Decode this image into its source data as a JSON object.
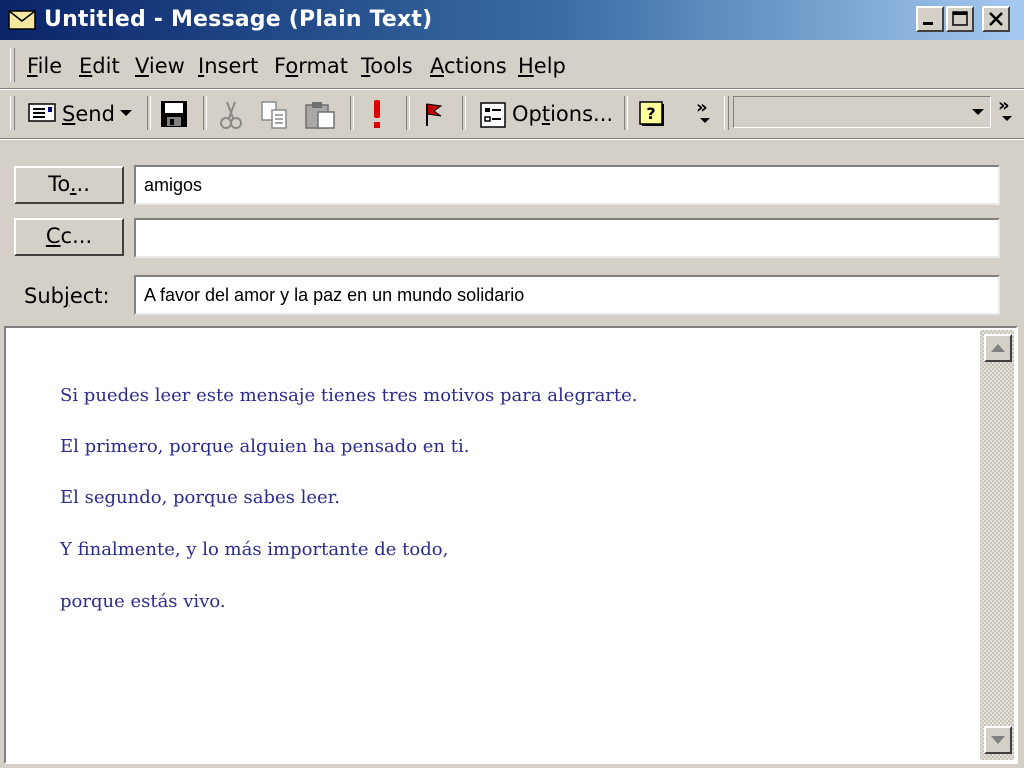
{
  "window": {
    "title": "Untitled - Message (Plain Text)",
    "icon": "envelope-icon",
    "controls": [
      "minimize-icon",
      "maximize-icon",
      "close-icon"
    ]
  },
  "menu": {
    "items": [
      {
        "accel": "F",
        "rest": "ile"
      },
      {
        "accel": "E",
        "rest": "dit"
      },
      {
        "accel": "V",
        "rest": "iew"
      },
      {
        "accel": "I",
        "rest": "nsert"
      },
      {
        "pre": "F",
        "accel": "o",
        "rest": "rmat"
      },
      {
        "accel": "T",
        "rest": "ools"
      },
      {
        "accel": "A",
        "rest": "ctions"
      },
      {
        "accel": "H",
        "rest": "elp"
      }
    ]
  },
  "toolbar": {
    "send_accel": "S",
    "send_rest": "end",
    "options_pre": "Op",
    "options_accel": "t",
    "options_rest": "ions...",
    "overflow": "»",
    "combo_value": ""
  },
  "header": {
    "to_button_pre": "To",
    "to_button_accel": ".",
    "to_button_rest": "..",
    "cc_button_accel": "C",
    "cc_button_rest": "c...",
    "subject_label_pre": "Sub",
    "subject_label_accel": "j",
    "subject_label_rest": "ect:",
    "to_value": "amigos",
    "cc_value": "",
    "subject_value": "A favor del amor y la paz en un mundo solidario"
  },
  "body": {
    "lines": [
      "Si puedes leer este mensaje tienes tres motivos para alegrarte.",
      "El primero, porque alguien ha pensado en ti.",
      "El segundo, porque sabes leer.",
      "Y finalmente, y lo más importante de todo,",
      "porque estás vivo."
    ],
    "text_color": "#2b2b8c"
  },
  "colors": {
    "titlebar_start": "#0a246a",
    "titlebar_end": "#a6caf0",
    "face": "#d4d0c8"
  }
}
